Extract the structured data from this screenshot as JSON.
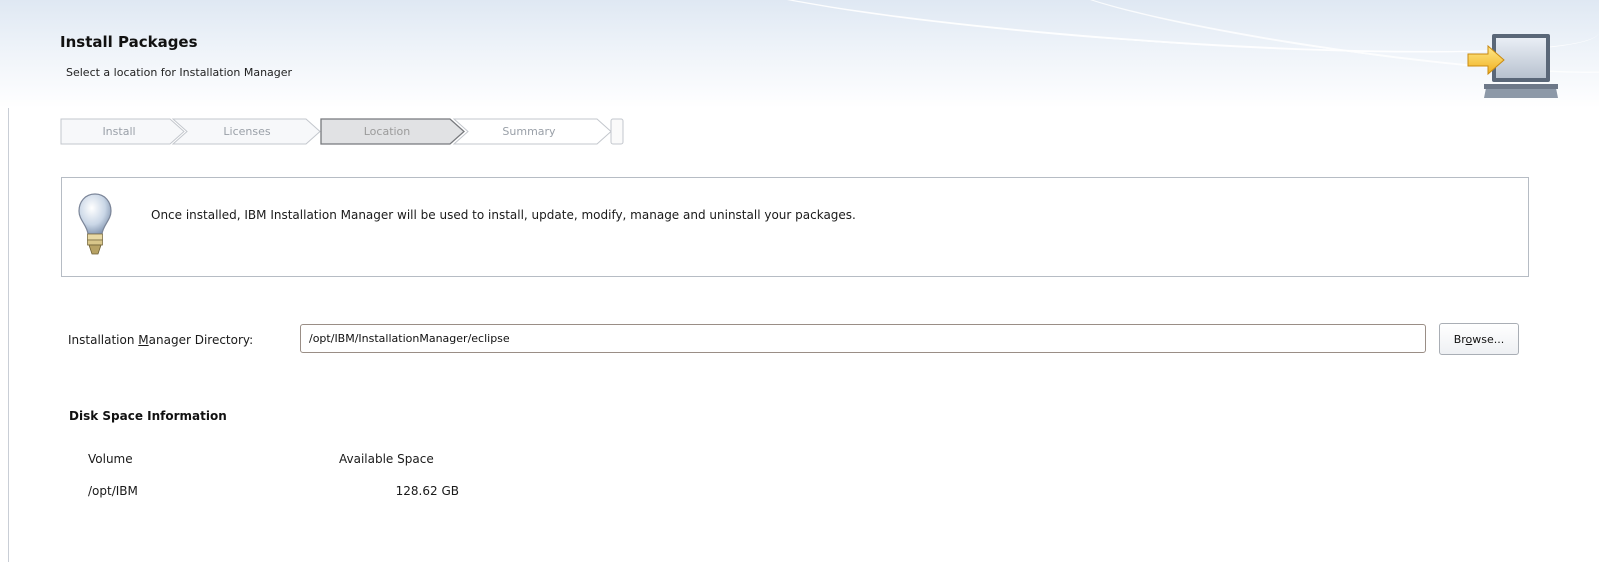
{
  "header": {
    "title": "Install Packages",
    "subtitle": "Select a location for Installation Manager",
    "icon": "install-banner-icon"
  },
  "wizard": {
    "steps": [
      {
        "label": "Install",
        "state": "completed"
      },
      {
        "label": "Licenses",
        "state": "completed"
      },
      {
        "label": "Location",
        "state": "current"
      },
      {
        "label": "Summary",
        "state": "pending"
      }
    ]
  },
  "info": {
    "icon": "lightbulb-icon",
    "message": "Once installed, IBM Installation Manager will be used to install, update, modify, manage and uninstall your packages."
  },
  "directory": {
    "label_before": "Installation ",
    "label_mnemonic": "M",
    "label_after": "anager Directory:",
    "value": "/opt/IBM/InstallationManager/eclipse",
    "browse_before": "Br",
    "browse_mnemonic": "o",
    "browse_after": "wse..."
  },
  "disk_space": {
    "title": "Disk Space Information",
    "columns": [
      "Volume",
      "Available Space"
    ],
    "rows": [
      {
        "volume": "/opt/IBM",
        "available": "128.62 GB"
      }
    ]
  },
  "colors": {
    "header_gradient_top": "#dfe8f3",
    "border": "#b6bcc4",
    "input_border": "#9a8e86"
  }
}
